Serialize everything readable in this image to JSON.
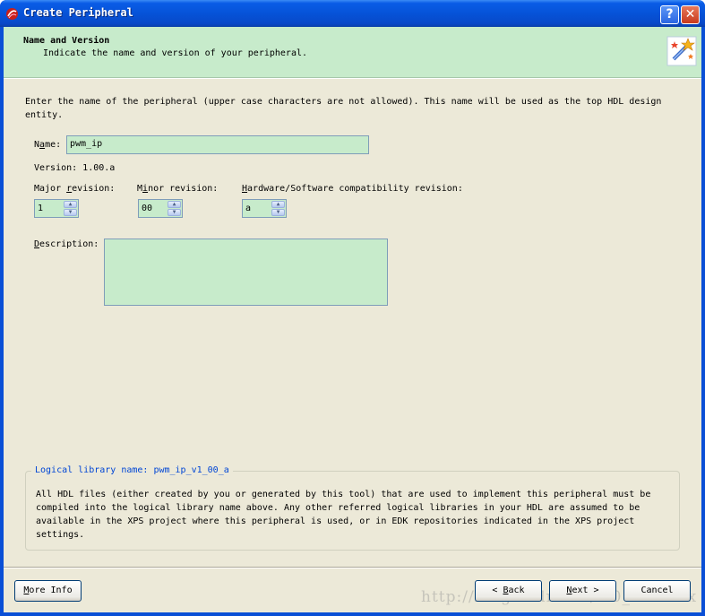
{
  "window": {
    "title": "Create Peripheral",
    "help_label": "?",
    "close_label": "✕"
  },
  "header": {
    "title": "Name and Version",
    "subtitle": "Indicate the name and version of your peripheral."
  },
  "intro_text": "Enter the name of the peripheral (upper case characters are not allowed). This name will be used as the top HDL design entity.",
  "name_field": {
    "label_prefix": "N",
    "label_mnemonic": "a",
    "label_rest": "me:",
    "value": "pwm_ip"
  },
  "version": {
    "text": "Version: 1.00.a"
  },
  "major_revision": {
    "label_prefix": "Major ",
    "label_mnemonic": "r",
    "label_rest": "evision:",
    "value": "1"
  },
  "minor_revision": {
    "label_prefix": "M",
    "label_mnemonic": "i",
    "label_rest": "nor revision:",
    "value": "00"
  },
  "hw_sw_revision": {
    "label_prefix": "",
    "label_mnemonic": "H",
    "label_rest": "ardware/Software compatibility revision:",
    "value": "a"
  },
  "description": {
    "label_prefix": "",
    "label_mnemonic": "D",
    "label_rest": "escription:",
    "value": ""
  },
  "library_group": {
    "legend": "Logical library name: pwm_ip_v1_00_a",
    "text": "All HDL files (either created by you or generated by this tool) that are used to implement this peripheral must be compiled into the logical library name above. Any other referred logical libraries in your HDL are assumed to be available in the XPS project where this peripheral is used, or in EDK repositories indicated in the XPS project settings."
  },
  "buttons": {
    "more_info_prefix": "",
    "more_info_mnemonic": "M",
    "more_info_rest": "ore Info",
    "back_prefix": "< ",
    "back_mnemonic": "B",
    "back_rest": "ack",
    "next_prefix": "",
    "next_mnemonic": "N",
    "next_rest": "ext >",
    "cancel": "Cancel"
  },
  "watermark": "http://blog.csdn.net/m0_xxxxxxx"
}
